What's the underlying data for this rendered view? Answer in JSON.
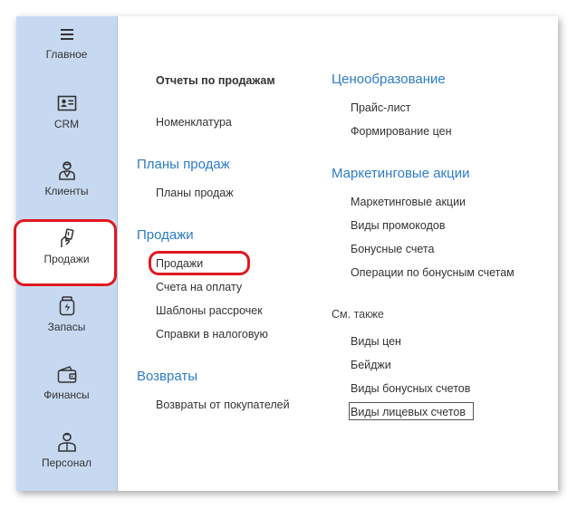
{
  "sidebar": {
    "items": [
      {
        "label": "Главное",
        "icon": "menu-icon"
      },
      {
        "label": "CRM",
        "icon": "contact-card-icon"
      },
      {
        "label": "Клиенты",
        "icon": "person-icon"
      },
      {
        "label": "Продажи",
        "icon": "sales-hand-icon"
      },
      {
        "label": "Запасы",
        "icon": "stock-jar-icon"
      },
      {
        "label": "Финансы",
        "icon": "wallet-icon"
      },
      {
        "label": "Персонал",
        "icon": "staff-icon"
      }
    ],
    "active": "Продажи"
  },
  "left_column": {
    "reports_title": "Отчеты по продажам",
    "nomenclature": "Номенклатура",
    "plans_header": "Планы продаж",
    "plans_link": "Планы продаж",
    "sales_header": "Продажи",
    "sales_links": [
      "Продажи",
      "Счета на оплату",
      "Шаблоны рассрочек",
      "Справки в налоговую"
    ],
    "returns_header": "Возвраты",
    "returns_link": "Возвраты от покупателей"
  },
  "right_column": {
    "pricing_header": "Ценообразование",
    "pricing_links": [
      "Прайс-лист",
      "Формирование цен"
    ],
    "marketing_header": "Маркетинговые акции",
    "marketing_links": [
      "Маркетинговые акции",
      "Виды промокодов",
      "Бонусные счета",
      "Операции по бонусным счетам"
    ],
    "see_also_header": "См. также",
    "see_also_links": [
      "Виды цен",
      "Бейджи",
      "Виды бонусных счетов",
      "Виды лицевых счетов"
    ]
  },
  "colors": {
    "accent": "#2c7cc7",
    "sidebar_bg": "#c7d9f1",
    "highlight": "#e0181f"
  }
}
